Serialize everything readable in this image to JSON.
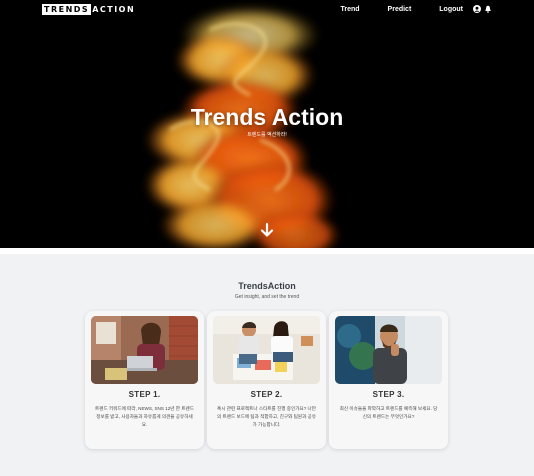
{
  "nav": {
    "logo_box": "TRENDS",
    "logo_rest": "ACTION",
    "links": [
      "Trend",
      "Predict",
      "Logout"
    ],
    "icons": [
      "user-icon",
      "bell-icon"
    ]
  },
  "hero": {
    "title": "Trends Action",
    "subtitle": "트렌드를 액션하라!"
  },
  "section": {
    "title": "TrendsAction",
    "subtitle": "Get insight, and set the trend"
  },
  "cards": [
    {
      "step": "STEP 1.",
      "desc": "트렌드 키워드에 따라, NEWS, SNS 12년 한 트렌드 정보를 받고, 사용자들과 자유롭게 의견을 공유하세요."
    },
    {
      "step": "STEP 2.",
      "desc": "혹시 관련 프로젝트나 스타트를 진행 중인가요? 나만의 트렌드 보드에 팀과 적합하고, 친구와 팀원과 공유가 가능합니다."
    },
    {
      "step": "STEP 3.",
      "desc": "최신 이슈들을 파악하고 트렌드를 예측해 보세요. 당신의 트렌드는 무엇인가요?"
    }
  ],
  "colors": {
    "hero_bg": "#000000",
    "section_bg": "#f1f2f4",
    "accent_orange": "#f07a18",
    "accent_yellow": "#f3c94a"
  }
}
